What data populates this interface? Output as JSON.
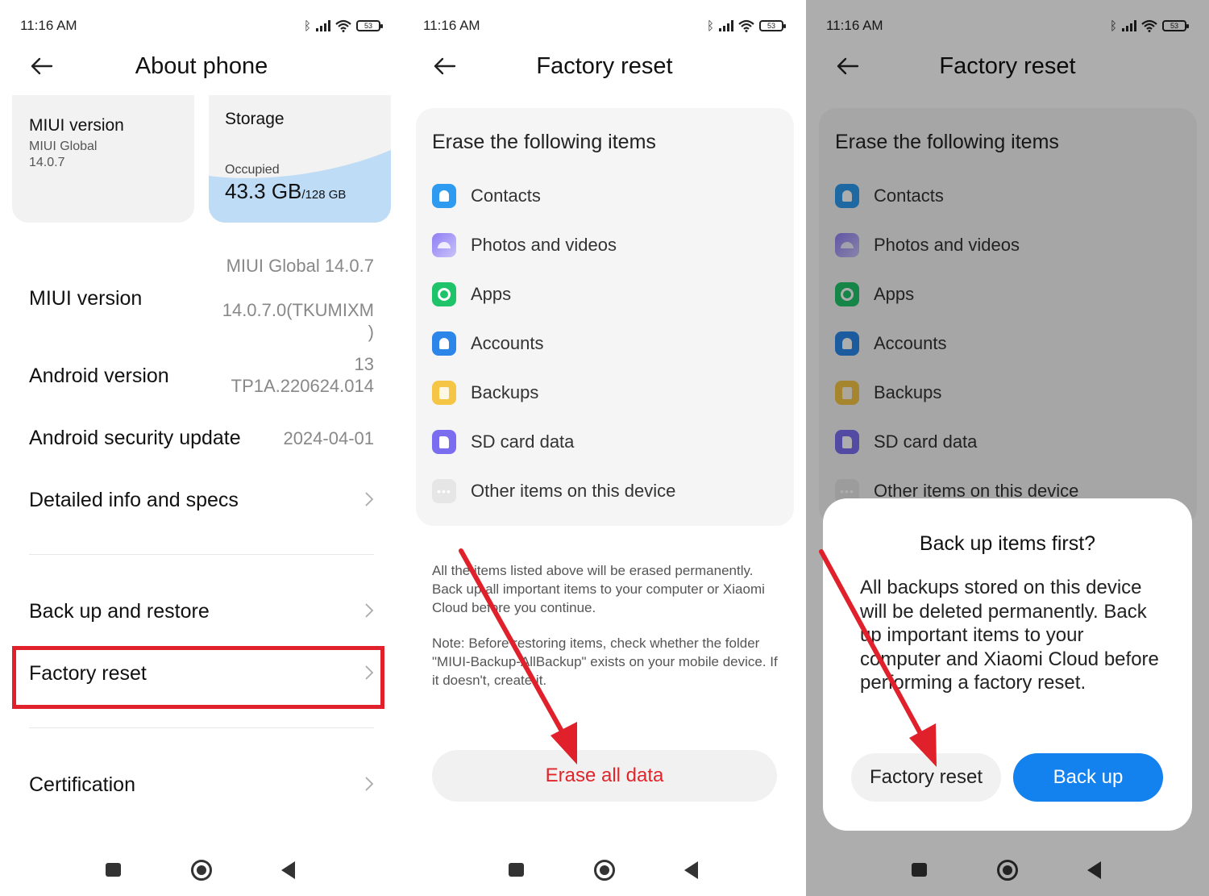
{
  "status_bar": {
    "time": "11:16 AM",
    "battery": "53"
  },
  "about_phone": {
    "title": "About phone",
    "miui_card": {
      "heading": "MIUI version",
      "line1": "MIUI Global",
      "line2": "14.0.7"
    },
    "storage_card": {
      "heading": "Storage",
      "occupied_label": "Occupied",
      "used": "43.3 GB",
      "total": "/128 GB"
    },
    "rows": {
      "miui_version": {
        "label": "MIUI version",
        "value1": "MIUI Global 14.0.7",
        "value2": "14.0.7.0(TKUMIXM",
        "value3": ")"
      },
      "android_version": {
        "label": "Android version",
        "value1": "13",
        "value2": "TP1A.220624.014"
      },
      "security_update": {
        "label": "Android security update",
        "value": "2024-04-01"
      },
      "detailed_info": {
        "label": "Detailed info and specs"
      },
      "backup_restore": {
        "label": "Back up and restore"
      },
      "factory_reset": {
        "label": "Factory reset"
      },
      "certification": {
        "label": "Certification"
      }
    }
  },
  "factory_reset": {
    "title": "Factory reset",
    "erase_heading": "Erase the following items",
    "items": [
      "Contacts",
      "Photos and videos",
      "Apps",
      "Accounts",
      "Backups",
      "SD card data",
      "Other items on this device"
    ],
    "note1": "All the items listed above will be erased permanently. Back up all important items to your computer or Xiaomi Cloud before you continue.",
    "note2": "Note: Before restoring items, check whether the folder \"MIUI-Backup-AllBackup\" exists on your mobile device. If it doesn't, create it.",
    "erase_button": "Erase all data"
  },
  "dialog": {
    "title": "Back up items first?",
    "body": "All backups stored on this device will be deleted permanently. Back up important items to your computer and Xiaomi Cloud before performing a factory reset.",
    "factory_reset_button": "Factory reset",
    "backup_button": "Back up"
  },
  "colors": {
    "highlight": "#e0202a",
    "arrow": "#e0202a",
    "primary_button": "#1381ee",
    "danger_text": "#e0262a"
  },
  "icons": [
    "bluetooth-icon",
    "signal-icon",
    "wifi-icon",
    "battery-icon",
    "back-arrow-icon",
    "chevron-right-icon",
    "contacts-icon",
    "photos-icon",
    "apps-icon",
    "accounts-icon",
    "backups-icon",
    "sd-card-icon",
    "other-items-icon",
    "recents-nav-icon",
    "home-nav-icon",
    "back-nav-icon"
  ]
}
